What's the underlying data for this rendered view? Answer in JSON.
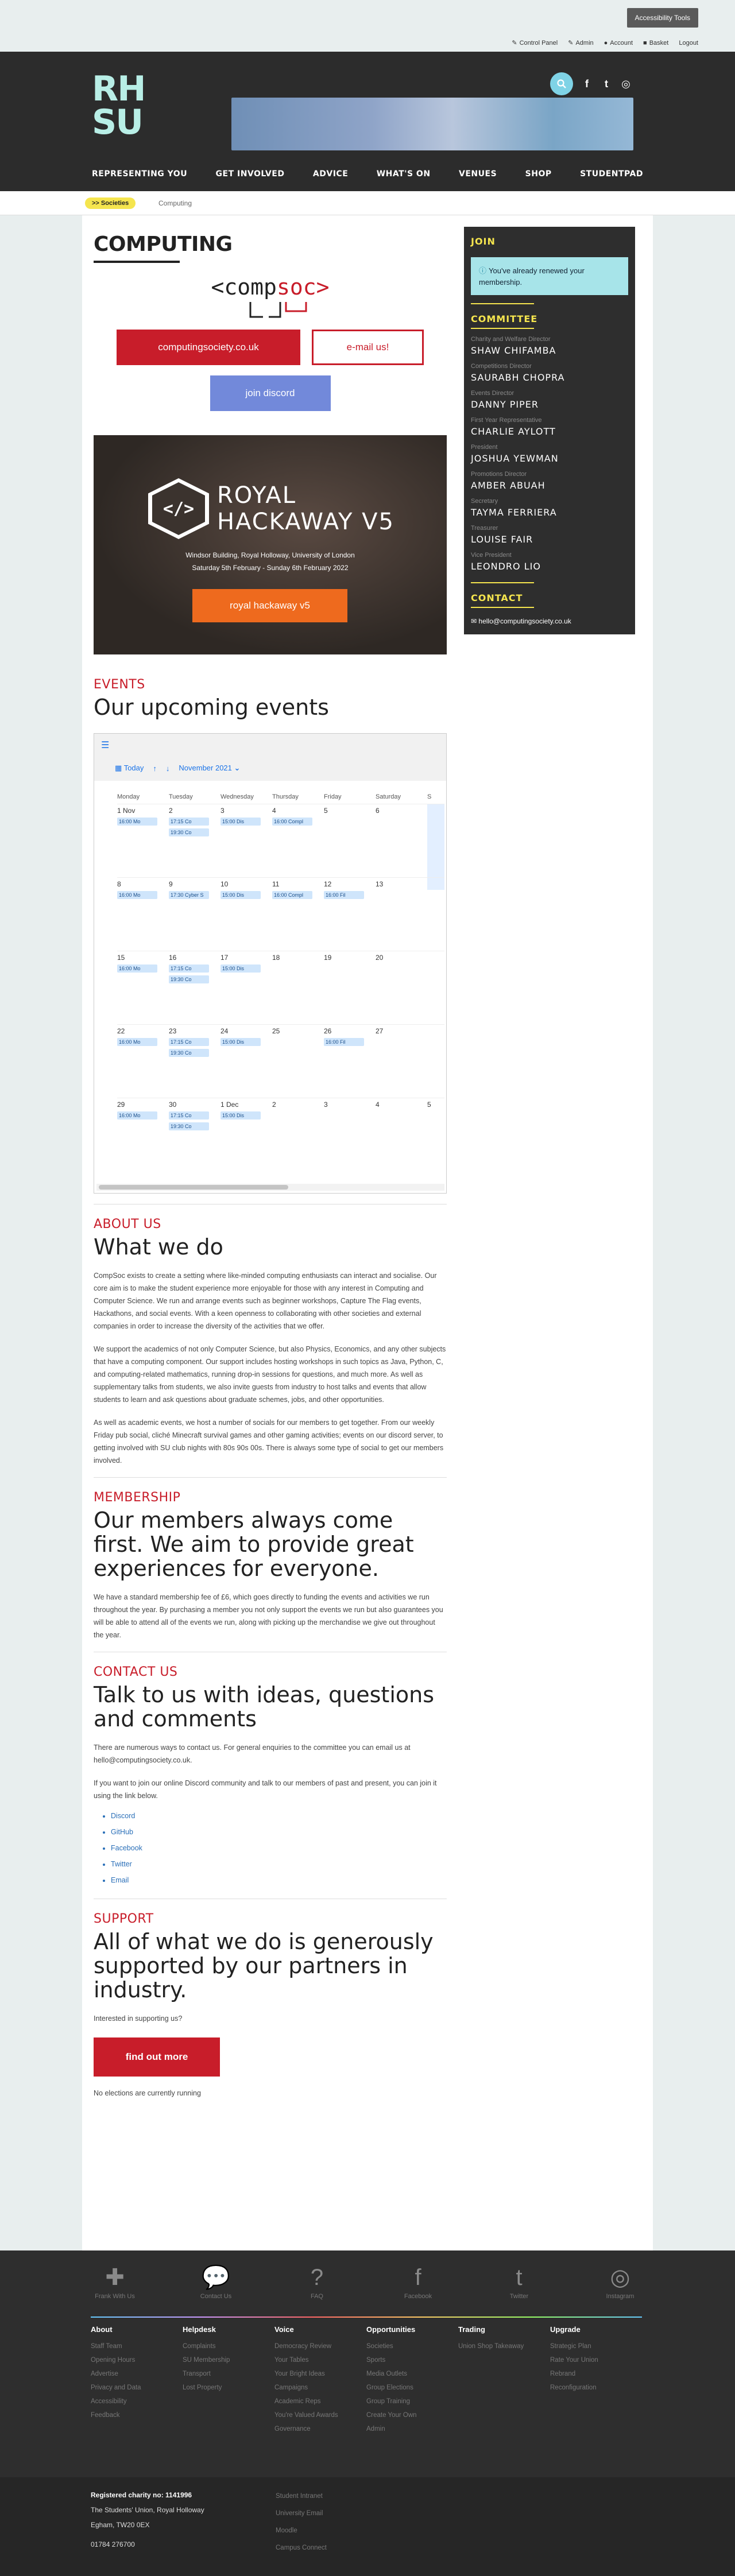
{
  "topbar": {
    "accessibility": "Accessibility Tools",
    "links": [
      "Control Panel",
      "Admin",
      "Account",
      "Basket",
      "Logout"
    ]
  },
  "header": {
    "logo": "RH SU",
    "nav": [
      "REPRESENTING YOU",
      "GET INVOLVED",
      "ADVICE",
      "WHAT'S ON",
      "VENUES",
      "SHOP",
      "STUDENTPAD"
    ]
  },
  "breadcrumb": {
    "parent": ">> Societies",
    "current": "Computing"
  },
  "page": {
    "title": "COMPUTING",
    "logo_text_left": "<comp",
    "logo_text_right": "soc>",
    "btn_site": "computingsociety.co.uk",
    "btn_email": "e-mail us!",
    "btn_discord": "join discord"
  },
  "hackaway": {
    "title_line1": "ROYAL",
    "title_line2": "HACKAWAY V5",
    "icon": "</>",
    "location": "Windsor Building, Royal Holloway, University of London",
    "dates": "Saturday 5th February - Sunday 6th February 2022",
    "button": "royal hackaway v5"
  },
  "events": {
    "heading": "EVENTS",
    "subheading": "Our upcoming events",
    "calendar": {
      "today": "Today",
      "month": "November 2021",
      "days": [
        "Monday",
        "Tuesday",
        "Wednesday",
        "Thursday",
        "Friday",
        "Saturday",
        "S"
      ],
      "weeks": [
        {
          "dates": [
            "1 Nov",
            "2",
            "3",
            "4",
            "5",
            "6",
            ""
          ],
          "events": [
            [
              "16:00 Mo"
            ],
            [
              "17:15 Co",
              "19:30 Co"
            ],
            [
              "15:00 Dis"
            ],
            [
              "16:00 Compl"
            ],
            [],
            [],
            []
          ]
        },
        {
          "dates": [
            "8",
            "9",
            "10",
            "11",
            "12",
            "13",
            ""
          ],
          "events": [
            [
              "16:00 Mo"
            ],
            [
              "17:30 Cyber S"
            ],
            [
              "15:00 Dis"
            ],
            [
              "16:00 Compl"
            ],
            [
              "16:00 Fil"
            ],
            [],
            []
          ]
        },
        {
          "dates": [
            "15",
            "16",
            "17",
            "18",
            "19",
            "20",
            ""
          ],
          "events": [
            [
              "16:00 Mo"
            ],
            [
              "17:15 Co",
              "19:30 Co"
            ],
            [
              "15:00 Dis"
            ],
            [],
            [],
            [],
            []
          ]
        },
        {
          "dates": [
            "22",
            "23",
            "24",
            "25",
            "26",
            "27",
            ""
          ],
          "events": [
            [
              "16:00 Mo"
            ],
            [
              "17:15 Co",
              "19:30 Co"
            ],
            [
              "15:00 Dis"
            ],
            [],
            [
              "16:00 Fil"
            ],
            [],
            []
          ]
        },
        {
          "dates": [
            "29",
            "30",
            "1 Dec",
            "2",
            "3",
            "4",
            "5"
          ],
          "events": [
            [
              "16:00 Mo"
            ],
            [
              "17:15 Co",
              "19:30 Co"
            ],
            [
              "15:00 Dis"
            ],
            [],
            [],
            [],
            []
          ]
        }
      ]
    }
  },
  "about": {
    "heading": "ABOUT US",
    "subheading": "What we do",
    "p1": "CompSoc exists to create a setting where like-minded computing enthusiasts can interact and socialise. Our core aim is to make the student experience more enjoyable for those with any interest in Computing and Computer Science. We run and arrange events such as beginner workshops, Capture The Flag events, Hackathons, and social events. With a keen openness to collaborating with other societies and external companies in order to increase the diversity of the activities that we offer.",
    "p2": "We support the academics of not only Computer Science, but also Physics, Economics, and any other subjects that have a computing component. Our support includes hosting workshops in such topics as Java, Python, C, and computing-related mathematics, running drop-in sessions for questions, and much more. As well as supplementary talks from students, we also invite guests from industry to host talks and events that allow students to learn and ask questions about graduate schemes, jobs, and other opportunities.",
    "p3": "As well as academic events, we host a number of socials for our members to get together. From our weekly Friday pub social, cliché Minecraft survival games and other gaming activities; events on our discord server, to getting involved with SU club nights with 80s 90s 00s. There is always some type of social to get our members involved."
  },
  "membership": {
    "heading": "MEMBERSHIP",
    "subheading": "Our members always come first. We aim to provide great experiences for everyone.",
    "p1": "We have a standard membership fee of £6, which goes directly to funding the events and activities we run throughout the year. By purchasing a member you not only support the events we run but also guarantees you will be able to attend all of the events we run, along with picking up the merchandise we give out throughout the year."
  },
  "contact": {
    "heading": "CONTACT US",
    "subheading": "Talk to us with ideas, questions and comments",
    "p1": "There are numerous ways to contact us. For general enquiries to the committee you can email us at hello@computingsociety.co.uk.",
    "p2": "If you want to join our online Discord community and talk to our members of past and present, you can join it using the link below.",
    "links": [
      "Discord",
      "GitHub",
      "Facebook",
      "Twitter",
      "Email"
    ]
  },
  "support": {
    "heading": "SUPPORT",
    "subheading": "All of what we do is generously supported by our partners in industry.",
    "p1": "Interested in supporting us?",
    "button": "find out more",
    "elections": "No elections are currently running"
  },
  "sidebar": {
    "join_heading": "JOIN",
    "notice": "You've already renewed your membership.",
    "committee_heading": "COMMITTEE",
    "committee": [
      {
        "role": "Charity and Welfare Director",
        "name": "SHAW CHIFAMBA"
      },
      {
        "role": "Competitions Director",
        "name": "SAURABH CHOPRA"
      },
      {
        "role": "Events Director",
        "name": "DANNY PIPER"
      },
      {
        "role": "First Year Representative",
        "name": "CHARLIE AYLOTT"
      },
      {
        "role": "President",
        "name": "JOSHUA YEWMAN"
      },
      {
        "role": "Promotions Director",
        "name": "AMBER ABUAH"
      },
      {
        "role": "Secretary",
        "name": "TAYMA FERRIERA"
      },
      {
        "role": "Treasurer",
        "name": "LOUISE FAIR"
      },
      {
        "role": "Vice President",
        "name": "LEONDRO LIO"
      }
    ],
    "contact_heading": "CONTACT",
    "email": "hello@computingsociety.co.uk"
  },
  "footer": {
    "icons": [
      {
        "icon": "plus-icon",
        "label": "Frank With Us"
      },
      {
        "icon": "chat-icon",
        "label": "Contact Us"
      },
      {
        "icon": "question-icon",
        "label": "FAQ"
      },
      {
        "icon": "facebook-icon",
        "label": "Facebook"
      },
      {
        "icon": "twitter-icon",
        "label": "Twitter"
      },
      {
        "icon": "instagram-icon",
        "label": "Instagram"
      }
    ],
    "columns": [
      {
        "title": "About",
        "links": [
          "Staff Team",
          "Opening Hours",
          "Advertise",
          "Privacy and Data",
          "Accessibility",
          "Feedback"
        ]
      },
      {
        "title": "Helpdesk",
        "links": [
          "Complaints",
          "SU Membership",
          "Transport",
          "Lost Property"
        ]
      },
      {
        "title": "Voice",
        "links": [
          "Democracy Review",
          "Your Tables",
          "Your Bright Ideas",
          "Campaigns",
          "Academic Reps",
          "You're Valued Awards",
          "Governance"
        ]
      },
      {
        "title": "Opportunities",
        "links": [
          "Societies",
          "Sports",
          "Media Outlets",
          "Group Elections",
          "Group Training",
          "Create Your Own",
          "Admin"
        ]
      },
      {
        "title": "Trading",
        "links": [
          "Union Shop Takeaway"
        ]
      },
      {
        "title": "Upgrade",
        "links": [
          "Strategic Plan",
          "Rate Your Union",
          "Rebrand",
          "Reconfiguration"
        ]
      }
    ],
    "charity": "Registered charity no: 1141996",
    "address1": "The Students' Union, Royal Holloway",
    "address2": "Egham, TW20 0EX",
    "phone": "01784 276700",
    "bottom_links": [
      "Student Intranet",
      "University Email",
      "Moodle",
      "Campus Connect"
    ]
  },
  "colors": {
    "accent": "#c81d2a",
    "dark": "#2e2e2e",
    "yellow": "#f5e54e",
    "notice": "#a7e4e9"
  }
}
